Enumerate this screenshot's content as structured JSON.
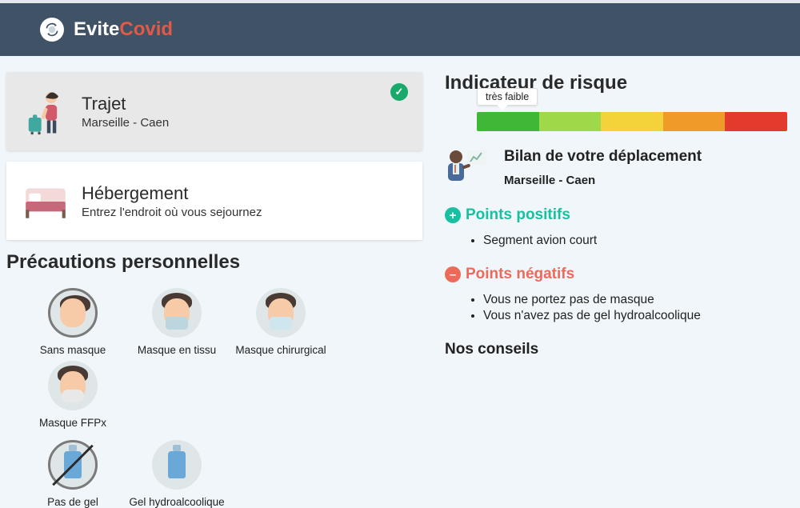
{
  "brand": {
    "part1": "Evite",
    "part2": "Covid",
    "logo_icon": "refresh-virus-icon"
  },
  "cards": {
    "trip": {
      "title": "Trajet",
      "subtitle": "Marseille - Caen",
      "completed": true
    },
    "lodging": {
      "title": "Hébergement",
      "subtitle": "Entrez l'endroit où vous sejournez",
      "completed": false
    }
  },
  "precautions": {
    "heading": "Précautions personnelles",
    "mask_options": [
      {
        "id": "no-mask",
        "label": "Sans masque",
        "selected": true
      },
      {
        "id": "cloth",
        "label": "Masque en tissu",
        "selected": false
      },
      {
        "id": "surgical",
        "label": "Masque chirurgical",
        "selected": false
      },
      {
        "id": "ffp",
        "label": "Masque FFPx",
        "selected": false
      }
    ],
    "gel_options": [
      {
        "id": "no-gel",
        "label": "Pas de gel",
        "selected": true
      },
      {
        "id": "gel",
        "label": "Gel hydroalcoolique",
        "selected": false
      }
    ]
  },
  "risk": {
    "heading": "Indicateur de risque",
    "level_label": "très faible",
    "level_index": 0,
    "segments": [
      "#3fb837",
      "#9fd94a",
      "#f3d23a",
      "#f09a2a",
      "#e23b2e"
    ]
  },
  "bilan": {
    "title": "Bilan de votre déplacement",
    "route": "Marseille - Caen"
  },
  "positives": {
    "heading": "Points positifs",
    "items": [
      "Segment avion court"
    ]
  },
  "negatives": {
    "heading": "Points négatifs",
    "items": [
      "Vous ne portez pas de masque",
      "Vous n'avez pas de gel hydroalcoolique"
    ]
  },
  "advice": {
    "heading": "Nos conseils"
  }
}
